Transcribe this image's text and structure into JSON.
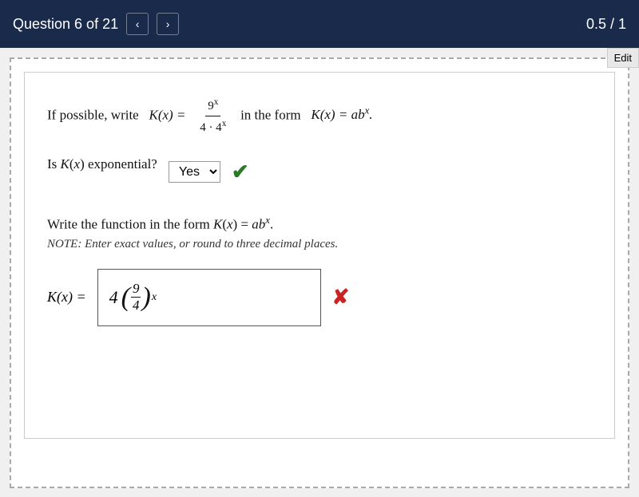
{
  "header": {
    "question_label": "Question 6 of 21",
    "score": "0.5 / 1",
    "nav_prev": "‹",
    "nav_next": "›"
  },
  "edit_button": "Edit",
  "question": {
    "line1_prefix": "If possible, write",
    "line1_function": "K(x) =",
    "line1_numerator": "9",
    "line1_denominator": "4 · 4",
    "line1_suffix": "in the form",
    "line1_form": "K(x) = ab",
    "is_exponential_label": "Is K(x) exponential?",
    "is_exponential_value": "Yes",
    "write_prompt": "Write the function in the form K(x) = ab",
    "note": "NOTE: Enter exact values, or round to three decimal places.",
    "answer_prefix": "K(x) =",
    "answer_coeff": "4",
    "answer_num": "9",
    "answer_den": "4",
    "answer_exp": "x",
    "correct_check": "✔",
    "wrong_x": "✘"
  }
}
